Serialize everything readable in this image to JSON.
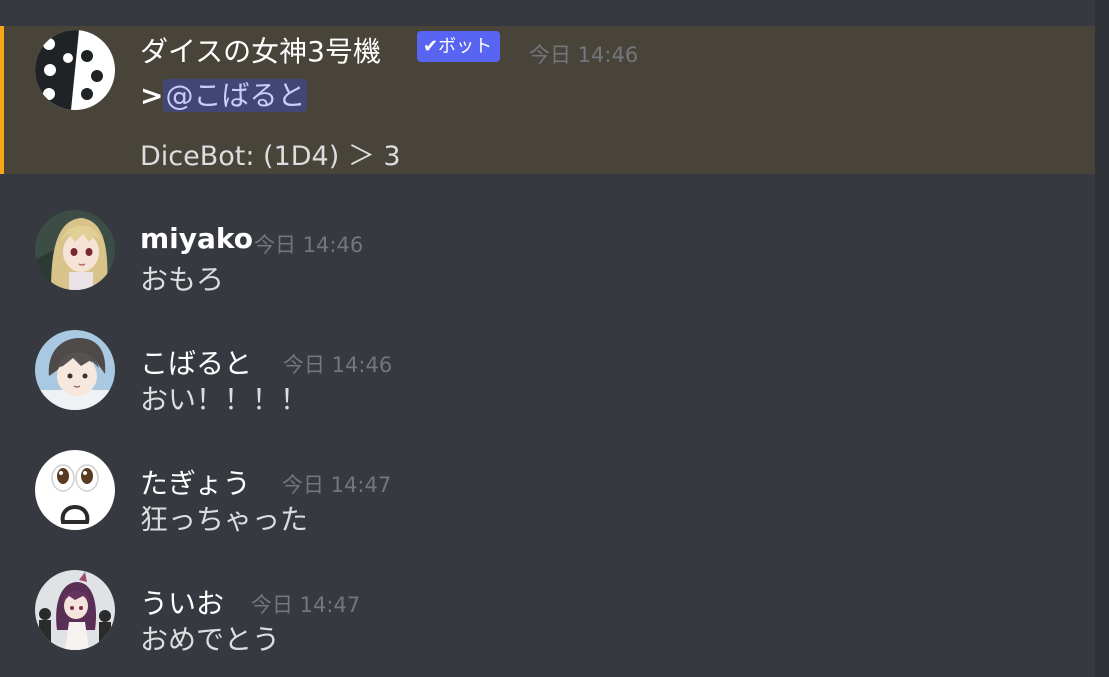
{
  "colors": {
    "background": "#36393f",
    "bot_highlight": "#49443a",
    "bot_accent": "#faa61a",
    "badge": "#5865f2",
    "mention_bg": "#414675",
    "timestamp": "#72767d"
  },
  "messages": [
    {
      "author": "ダイスの女神3号機",
      "badge": "✔ボット",
      "timestamp": "今日 14:46",
      "prefix": ">",
      "mention": "@こばると",
      "roll": "DiceBot: (1D4) ＞ 3",
      "avatar_icon": "dice-avatar-icon"
    },
    {
      "author": "miyako",
      "timestamp": "今日 14:46",
      "text": "おもろ",
      "avatar_icon": "anime-girl-avatar-icon"
    },
    {
      "author": "こばると",
      "timestamp": "今日 14:46",
      "text": "おい！！！！",
      "avatar_icon": "anime-boy-avatar-icon"
    },
    {
      "author": "たぎょう",
      "timestamp": "今日 14:47",
      "text": "狂っちゃった",
      "avatar_icon": "surprised-face-avatar-icon"
    },
    {
      "author": "ういお",
      "timestamp": "今日 14:47",
      "text": "おめでとう",
      "avatar_icon": "anime-character-avatar-icon"
    }
  ]
}
